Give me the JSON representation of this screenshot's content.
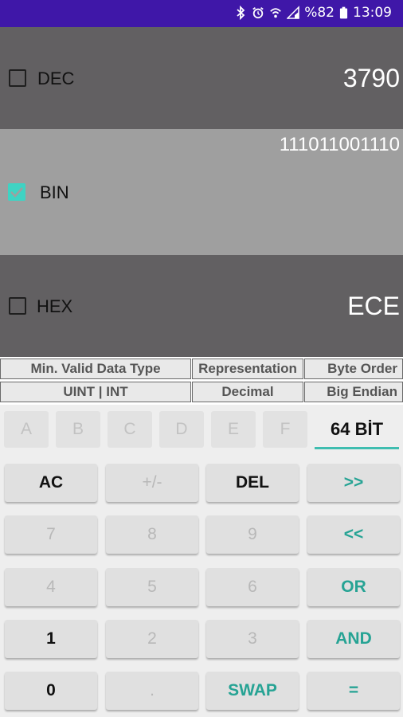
{
  "statusbar": {
    "battery_text": "%82",
    "time": "13:09"
  },
  "dec": {
    "label": "DEC",
    "value": "3790",
    "checked": false
  },
  "bin": {
    "label": "BIN",
    "value": "111011001110",
    "checked": true
  },
  "hex": {
    "label": "HEX",
    "value": "ECE",
    "checked": false
  },
  "info": {
    "headers": [
      "Min. Valid Data Type",
      "Representation",
      "Byte Order"
    ],
    "values": [
      "UINT | INT",
      "Decimal",
      "Big Endian"
    ]
  },
  "hex_keys": [
    "A",
    "B",
    "C",
    "D",
    "E",
    "F"
  ],
  "bit_mode": "64 BİT",
  "keypad": [
    [
      "AC",
      "+/-",
      "DEL",
      ">>"
    ],
    [
      "7",
      "8",
      "9",
      "<<"
    ],
    [
      "4",
      "5",
      "6",
      "OR"
    ],
    [
      "1",
      "2",
      "3",
      "AND"
    ],
    [
      "0",
      ".",
      "SWAP",
      "="
    ]
  ],
  "colors": {
    "accent": "#3fd3c3",
    "teal_text": "#26a394",
    "statusbar": "#3f17a8"
  }
}
